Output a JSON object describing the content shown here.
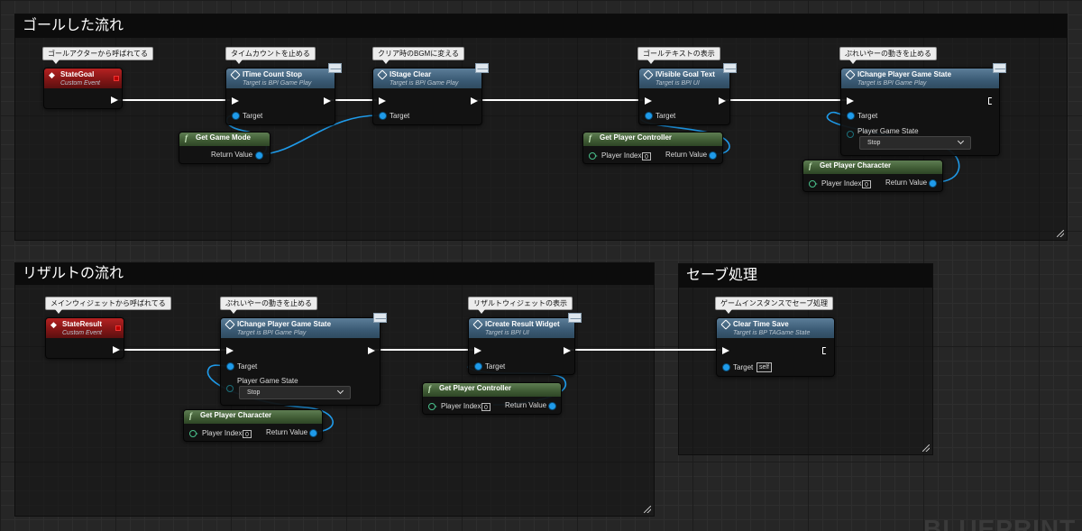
{
  "comments": {
    "goal": "ゴールした流れ",
    "result": "リザルトの流れ",
    "save": "セーブ処理"
  },
  "bubbles": {
    "goal_event": "ゴールアクターから呼ばれてる",
    "time_stop": "タイムカウントを止める",
    "stage_clear": "クリア時のBGMに変える",
    "goal_text": "ゴールテキストの表示",
    "player_stop_1": "ぷれいやーの動きを止める",
    "result_event": "メインウィジェットから呼ばれてる",
    "player_stop_2": "ぷれいやーの動きを止める",
    "result_widget": "リザルトウィジェットの表示",
    "save_game": "ゲームインスタンスでセーブ処理"
  },
  "nodes": {
    "state_goal": {
      "title": "StateGoal",
      "sub": "Custom Event"
    },
    "time_stop": {
      "title": "ITime Count Stop",
      "sub": "Target is BPI Game Play",
      "target": "Target"
    },
    "stage_clear": {
      "title": "IStage Clear",
      "sub": "Target is BPI Game Play",
      "target": "Target"
    },
    "visible_goal": {
      "title": "IVisible Goal Text",
      "sub": "Target is BPI UI",
      "target": "Target"
    },
    "change_state_1": {
      "title": "IChange Player Game State",
      "sub": "Target is BPI Game Play",
      "target": "Target",
      "param": "Player Game State",
      "value": "Stop"
    },
    "get_game_mode": {
      "title": "Get Game Mode",
      "ret": "Return Value"
    },
    "get_pc_1": {
      "title": "Get Player Controller",
      "idx_label": "Player Index",
      "idx": "0",
      "ret": "Return Value"
    },
    "get_char_1": {
      "title": "Get Player Character",
      "idx_label": "Player Index",
      "idx": "0",
      "ret": "Return Value"
    },
    "state_result": {
      "title": "StateResult",
      "sub": "Custom Event"
    },
    "change_state_2": {
      "title": "IChange Player Game State",
      "sub": "Target is BPI Game Play",
      "target": "Target",
      "param": "Player Game State",
      "value": "Stop"
    },
    "create_result": {
      "title": "ICreate Result Widget",
      "sub": "Target is BPI UI",
      "target": "Target"
    },
    "clear_time_save": {
      "title": "Clear Time Save",
      "sub": "Target is BP TAGame State",
      "target": "Target",
      "self": "self"
    },
    "get_char_2": {
      "title": "Get Player Character",
      "idx_label": "Player Index",
      "idx": "0",
      "ret": "Return Value"
    },
    "get_pc_2": {
      "title": "Get Player Controller",
      "idx_label": "Player Index",
      "idx": "0",
      "ret": "Return Value"
    }
  },
  "watermark": "BLUEPRINT",
  "colors": {
    "background": "#262626",
    "exec_wire": "#ffffff",
    "object_wire": "#1f9bea",
    "event_header": "#9a1b1b",
    "function_header": "#3a5a74",
    "pure_header": "#3e5a33"
  }
}
